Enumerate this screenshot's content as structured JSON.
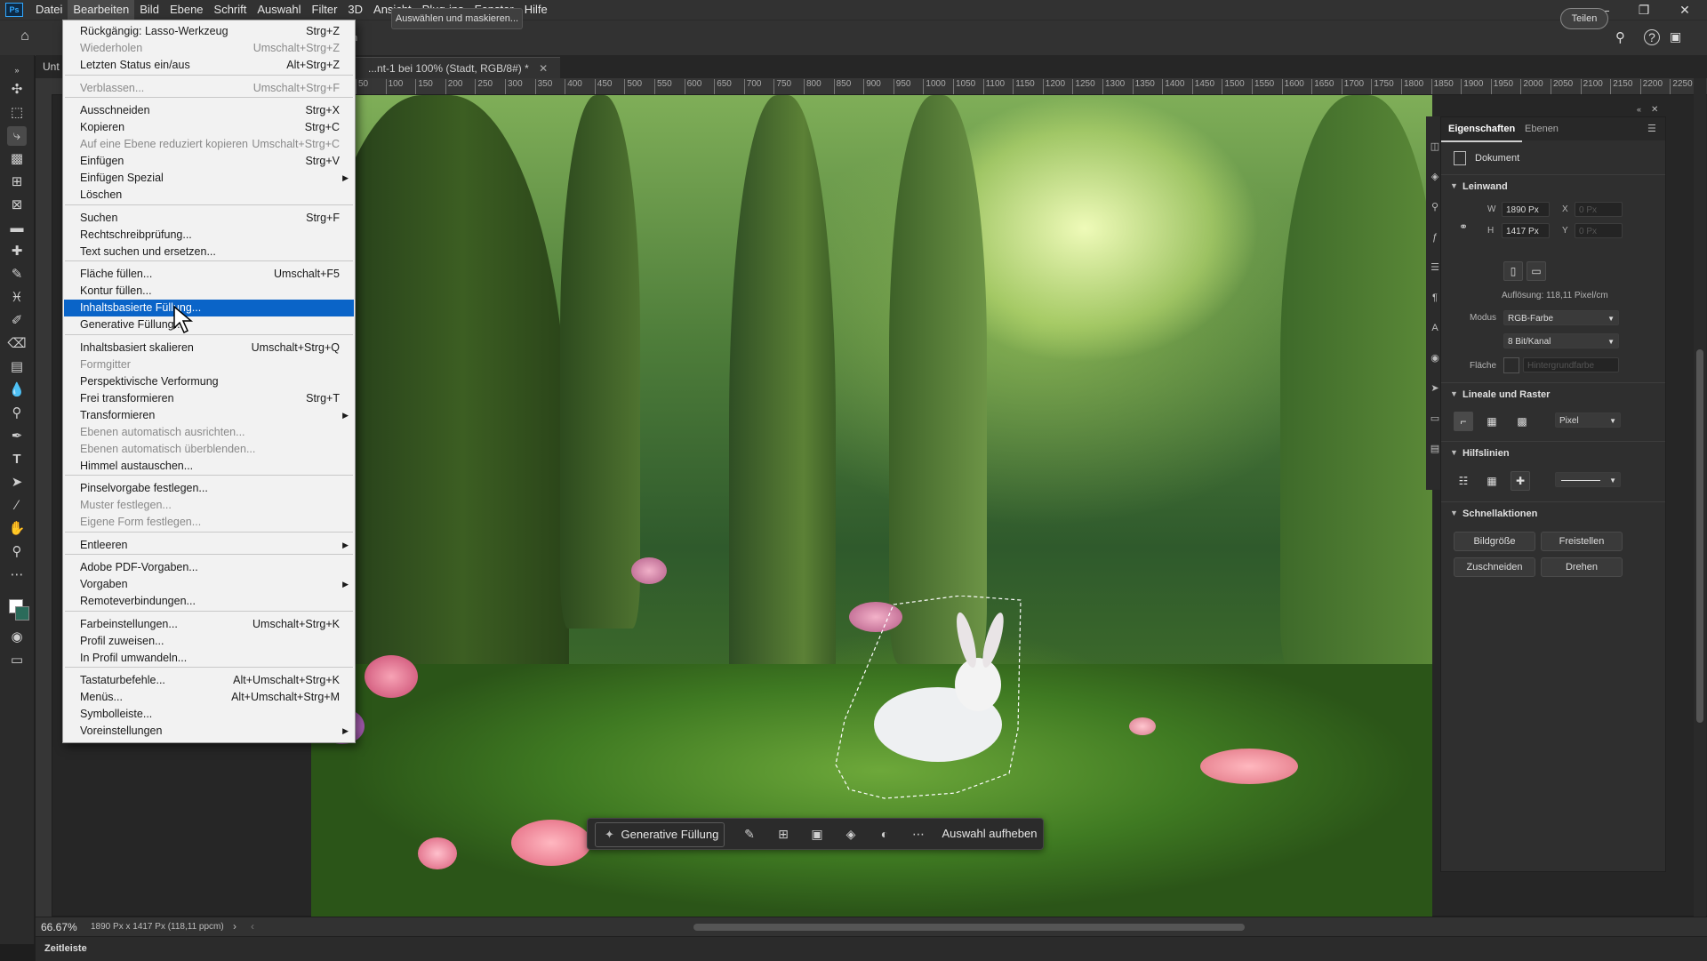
{
  "menubar": {
    "logo": "Ps",
    "items": [
      "Datei",
      "Bearbeiten",
      "Bild",
      "Ebene",
      "Schrift",
      "Auswahl",
      "Filter",
      "3D",
      "Ansicht",
      "Plug-ins",
      "Fenster",
      "Hilfe"
    ],
    "active_index": 1
  },
  "optionsbar": {
    "partial_label": "n",
    "select_mask_label": "Auswählen und maskieren...",
    "share_label": "Teilen"
  },
  "document_tab": {
    "prefix": "Unt",
    "title": "...nt-1 bei 100% (Stadt, RGB/8#) *"
  },
  "rulers": {
    "top": [
      "50",
      "100",
      "150",
      "200",
      "250",
      "300",
      "350",
      "400",
      "450",
      "500",
      "550",
      "600",
      "650",
      "700",
      "750",
      "800",
      "850",
      "900",
      "950",
      "1000",
      "1050",
      "1100",
      "1150",
      "1200",
      "1250",
      "1300",
      "1350",
      "1400",
      "1450",
      "1500",
      "1550",
      "1600",
      "1650",
      "1700",
      "1750",
      "1800",
      "1850",
      "1900",
      "1950",
      "2000",
      "2050",
      "2100",
      "2150",
      "2200",
      "2250"
    ]
  },
  "edit_menu": {
    "items": [
      {
        "label": "Rückgängig: Lasso-Werkzeug",
        "shortcut": "Strg+Z"
      },
      {
        "label": "Wiederholen",
        "shortcut": "Umschalt+Strg+Z",
        "disabled": true
      },
      {
        "label": "Letzten Status ein/aus",
        "shortcut": "Alt+Strg+Z"
      },
      {
        "label": "Verblassen...",
        "shortcut": "Umschalt+Strg+F",
        "disabled": true
      },
      {
        "label": "Ausschneiden",
        "shortcut": "Strg+X"
      },
      {
        "label": "Kopieren",
        "shortcut": "Strg+C"
      },
      {
        "label": "Auf eine Ebene reduziert kopieren",
        "shortcut": "Umschalt+Strg+C",
        "disabled": true
      },
      {
        "label": "Einfügen",
        "shortcut": "Strg+V"
      },
      {
        "label": "Einfügen Spezial",
        "submenu": true
      },
      {
        "label": "Löschen"
      },
      {
        "label": "Suchen",
        "shortcut": "Strg+F"
      },
      {
        "label": "Rechtschreibprüfung..."
      },
      {
        "label": "Text suchen und ersetzen..."
      },
      {
        "label": "Fläche füllen...",
        "shortcut": "Umschalt+F5"
      },
      {
        "label": "Kontur füllen..."
      },
      {
        "label": "Inhaltsbasierte Füllung...",
        "highlighted": true
      },
      {
        "label": "Generative Füllung..."
      },
      {
        "label": "Inhaltsbasiert skalieren",
        "shortcut": "Umschalt+Strg+Q"
      },
      {
        "label": "Formgitter",
        "disabled": true
      },
      {
        "label": "Perspektivische Verformung"
      },
      {
        "label": "Frei transformieren",
        "shortcut": "Strg+T"
      },
      {
        "label": "Transformieren",
        "submenu": true
      },
      {
        "label": "Ebenen automatisch ausrichten...",
        "disabled": true
      },
      {
        "label": "Ebenen automatisch überblenden...",
        "disabled": true
      },
      {
        "label": "Himmel austauschen..."
      },
      {
        "label": "Pinselvorgabe festlegen..."
      },
      {
        "label": "Muster festlegen...",
        "disabled": true
      },
      {
        "label": "Eigene Form festlegen...",
        "disabled": true
      },
      {
        "label": "Entleeren",
        "submenu": true
      },
      {
        "label": "Adobe PDF-Vorgaben..."
      },
      {
        "label": "Vorgaben",
        "submenu": true
      },
      {
        "label": "Remoteverbindungen..."
      },
      {
        "label": "Farbeinstellungen...",
        "shortcut": "Umschalt+Strg+K"
      },
      {
        "label": "Profil zuweisen..."
      },
      {
        "label": "In Profil umwandeln..."
      },
      {
        "label": "Tastaturbefehle...",
        "shortcut": "Alt+Umschalt+Strg+K"
      },
      {
        "label": "Menüs...",
        "shortcut": "Alt+Umschalt+Strg+M"
      },
      {
        "label": "Symbolleiste..."
      },
      {
        "label": "Voreinstellungen",
        "submenu": true
      }
    ]
  },
  "taskbar": {
    "generative_fill_label": "Generative Füllung",
    "deselect_label": "Auswahl aufheben",
    "icons": [
      "brush-icon",
      "transform-icon",
      "mask-icon",
      "fill-icon",
      "invert-icon",
      "more-icon"
    ]
  },
  "properties_panel": {
    "tabs": [
      "Eigenschaften",
      "Ebenen"
    ],
    "active_tab": 0,
    "document_label": "Dokument",
    "canvas": {
      "title": "Leinwand",
      "w_label": "W",
      "w_value": "1890 Px",
      "h_label": "H",
      "h_value": "1417 Px",
      "x_label": "X",
      "x_value": "0 Px",
      "y_label": "Y",
      "y_value": "0 Px",
      "resolution": "Auflösung: 118,11 Pixel/cm",
      "mode_label": "Modus",
      "mode_value": "RGB-Farbe",
      "depth_value": "8 Bit/Kanal",
      "fill_label": "Fläche",
      "fill_value": "Hintergrundfarbe"
    },
    "rulers_grid": {
      "title": "Lineale und Raster",
      "unit": "Pixel"
    },
    "guides": {
      "title": "Hilfslinien"
    },
    "quick_actions": {
      "title": "Schnellaktionen",
      "buttons": [
        "Bildgröße",
        "Freistellen",
        "Zuschneiden",
        "Drehen"
      ]
    }
  },
  "statusbar": {
    "zoom": "66.67%",
    "info": "1890 Px x 1417 Px (118,11 ppcm)"
  },
  "timeline": {
    "label": "Zeitleiste"
  },
  "colors": {
    "accent": "#0a64c8",
    "ui_bg": "#323232",
    "menu_bg": "#f2f2f2"
  }
}
